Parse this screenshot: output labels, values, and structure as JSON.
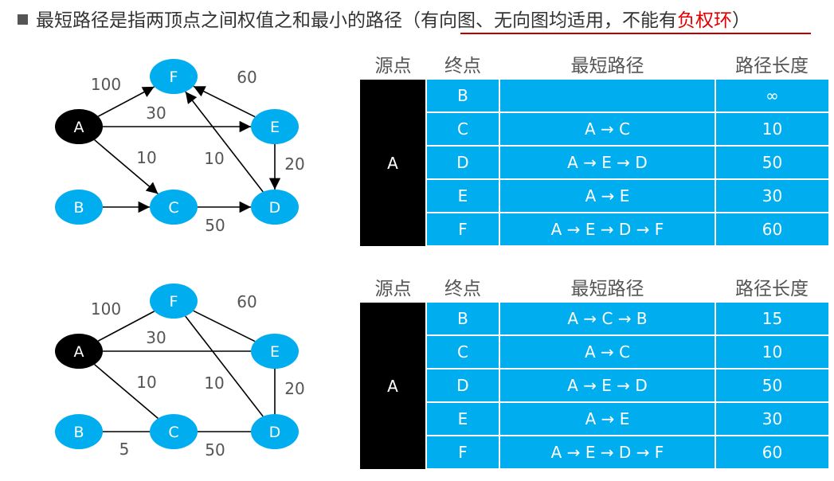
{
  "header": {
    "text_main": "最短路径是指两顶点之间权值之和最小的路径",
    "text_paren": "（有向图、无向图均适用，不能有",
    "text_red": "负权环",
    "text_close": "）"
  },
  "colors": {
    "node": "#00aeef",
    "source_node": "#000000",
    "table_cell": "#00aeef",
    "warning": "#e00000"
  },
  "graph": {
    "nodes": [
      "A",
      "B",
      "C",
      "D",
      "E",
      "F"
    ],
    "edges": [
      {
        "from": "A",
        "to": "F",
        "weight": "100"
      },
      {
        "from": "A",
        "to": "E",
        "weight": "30"
      },
      {
        "from": "A",
        "to": "C",
        "weight": "10"
      },
      {
        "from": "E",
        "to": "F",
        "weight": "60"
      },
      {
        "from": "D",
        "to": "F",
        "weight": "10"
      },
      {
        "from": "E",
        "to": "D",
        "weight": "20"
      },
      {
        "from": "B",
        "to": "C",
        "weight": "5"
      },
      {
        "from": "C",
        "to": "D",
        "weight": "50"
      }
    ]
  },
  "directed_table": {
    "headers": [
      "源点",
      "终点",
      "最短路径",
      "路径长度"
    ],
    "source": "A",
    "rows": [
      {
        "dest": "B",
        "path": "",
        "length": "∞"
      },
      {
        "dest": "C",
        "path": "A → C",
        "length": "10"
      },
      {
        "dest": "D",
        "path": "A → E → D",
        "length": "50"
      },
      {
        "dest": "E",
        "path": "A → E",
        "length": "30"
      },
      {
        "dest": "F",
        "path": "A → E → D → F",
        "length": "60"
      }
    ]
  },
  "undirected_table": {
    "headers": [
      "源点",
      "终点",
      "最短路径",
      "路径长度"
    ],
    "source": "A",
    "rows": [
      {
        "dest": "B",
        "path": "A → C → B",
        "length": "15"
      },
      {
        "dest": "C",
        "path": "A → C",
        "length": "10"
      },
      {
        "dest": "D",
        "path": "A → E → D",
        "length": "50"
      },
      {
        "dest": "E",
        "path": "A → E",
        "length": "30"
      },
      {
        "dest": "F",
        "path": "A → E → D → F",
        "length": "60"
      }
    ]
  }
}
